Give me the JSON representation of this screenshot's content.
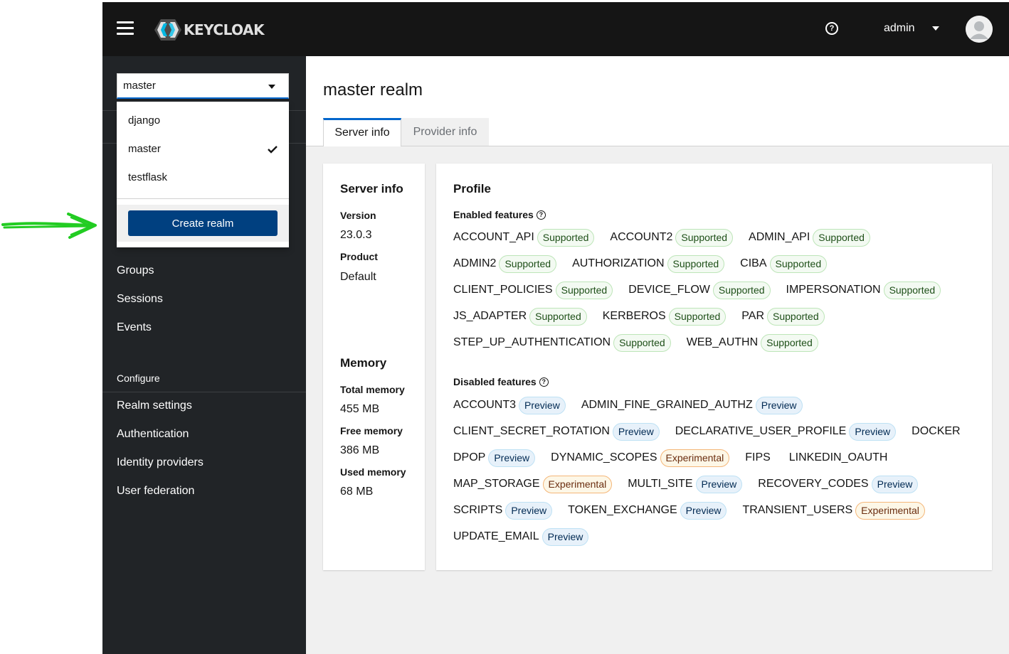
{
  "header": {
    "logo_text": "KEYCLOAK",
    "user_name": "admin"
  },
  "sidebar": {
    "realm_selected": "master",
    "realm_options": [
      "django",
      "master",
      "testflask"
    ],
    "create_realm_label": "Create realm",
    "nav_items": [
      "Groups",
      "Sessions",
      "Events"
    ],
    "configure_heading": "Configure",
    "configure_items": [
      "Realm settings",
      "Authentication",
      "Identity providers",
      "User federation"
    ]
  },
  "main": {
    "title": "master realm",
    "tabs": [
      "Server info",
      "Provider info"
    ],
    "server_info": {
      "heading": "Server info",
      "version_label": "Version",
      "version_value": "23.0.3",
      "product_label": "Product",
      "product_value": "Default"
    },
    "memory": {
      "heading": "Memory",
      "total_label": "Total memory",
      "total_value": "455 MB",
      "free_label": "Free memory",
      "free_value": "386 MB",
      "used_label": "Used memory",
      "used_value": "68 MB"
    },
    "profile": {
      "heading": "Profile",
      "enabled_heading": "Enabled features",
      "enabled_rows": [
        [
          {
            "name": "ACCOUNT_API",
            "badge": "Supported"
          },
          {
            "name": "ACCOUNT2",
            "badge": "Supported"
          },
          {
            "name": "ADMIN_API",
            "badge": "Supported"
          }
        ],
        [
          {
            "name": "ADMIN2",
            "badge": "Supported"
          },
          {
            "name": "AUTHORIZATION",
            "badge": "Supported"
          },
          {
            "name": "CIBA",
            "badge": "Supported"
          }
        ],
        [
          {
            "name": "CLIENT_POLICIES",
            "badge": "Supported"
          },
          {
            "name": "DEVICE_FLOW",
            "badge": "Supported"
          },
          {
            "name": "IMPERSONATION",
            "badge": "Supported"
          }
        ],
        [
          {
            "name": "JS_ADAPTER",
            "badge": "Supported"
          },
          {
            "name": "KERBEROS",
            "badge": "Supported"
          },
          {
            "name": "PAR",
            "badge": "Supported"
          }
        ],
        [
          {
            "name": "STEP_UP_AUTHENTICATION",
            "badge": "Supported"
          },
          {
            "name": "WEB_AUTHN",
            "badge": "Supported"
          }
        ]
      ],
      "disabled_heading": "Disabled features",
      "disabled_rows": [
        [
          {
            "name": "ACCOUNT3",
            "badge": "Preview"
          },
          {
            "name": "ADMIN_FINE_GRAINED_AUTHZ",
            "badge": "Preview"
          }
        ],
        [
          {
            "name": "CLIENT_SECRET_ROTATION",
            "badge": "Preview"
          },
          {
            "name": "DECLARATIVE_USER_PROFILE",
            "badge": "Preview"
          },
          {
            "name": "DOCKER",
            "badge": ""
          }
        ],
        [
          {
            "name": "DPOP",
            "badge": "Preview"
          },
          {
            "name": "DYNAMIC_SCOPES",
            "badge": "Experimental"
          },
          {
            "name": "FIPS",
            "badge": ""
          },
          {
            "name": "LINKEDIN_OAUTH",
            "badge": ""
          }
        ],
        [
          {
            "name": "MAP_STORAGE",
            "badge": "Experimental"
          },
          {
            "name": "MULTI_SITE",
            "badge": "Preview"
          },
          {
            "name": "RECOVERY_CODES",
            "badge": "Preview"
          }
        ],
        [
          {
            "name": "SCRIPTS",
            "badge": "Preview"
          },
          {
            "name": "TOKEN_EXCHANGE",
            "badge": "Preview"
          },
          {
            "name": "TRANSIENT_USERS",
            "badge": "Experimental"
          }
        ],
        [
          {
            "name": "UPDATE_EMAIL",
            "badge": "Preview"
          }
        ]
      ]
    }
  },
  "colors": {
    "header_bg": "#151515",
    "sidebar_bg": "#212427",
    "primary_button": "#004080",
    "active_tab_accent": "#0066cc",
    "annotation_arrow": "#22cc22"
  }
}
